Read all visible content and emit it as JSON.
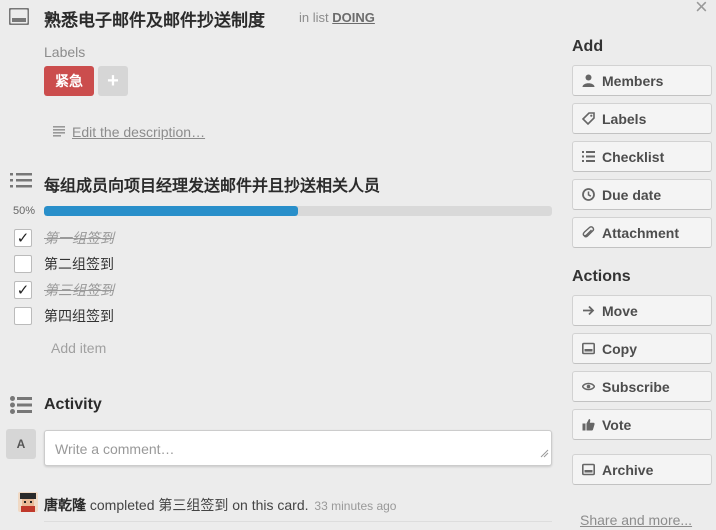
{
  "card": {
    "title": "熟悉电子邮件及邮件抄送制度",
    "in_list_prefix": "in list",
    "list_name": "DOING",
    "close_glyph": "×"
  },
  "labels": {
    "title": "Labels",
    "items": [
      {
        "text": "紧急",
        "color": "#cb4d4d"
      }
    ],
    "add_glyph": "+"
  },
  "description": {
    "edit_link": "Edit the description…"
  },
  "checklist": {
    "title": "每组成员向项目经理发送邮件并且抄送相关人员",
    "percent_label": "50%",
    "progress": 0.5,
    "items": [
      {
        "text": "第一组签到",
        "checked": true
      },
      {
        "text": "第二组签到",
        "checked": false
      },
      {
        "text": "第三组签到",
        "checked": true
      },
      {
        "text": "第四组签到",
        "checked": false
      }
    ],
    "add_item": "Add item"
  },
  "activity": {
    "title": "Activity",
    "avatar_initial": "A",
    "comment_placeholder": "Write a comment…",
    "entry": {
      "user": "唐乾隆",
      "action": "completed 第三组签到 on this card.",
      "time": "33 minutes ago"
    }
  },
  "sidebar": {
    "add_title": "Add",
    "add_buttons": [
      {
        "label": "Members",
        "icon": "person-icon"
      },
      {
        "label": "Labels",
        "icon": "tag-icon"
      },
      {
        "label": "Checklist",
        "icon": "checklist-icon"
      },
      {
        "label": "Due date",
        "icon": "clock-icon"
      },
      {
        "label": "Attachment",
        "icon": "paperclip-icon"
      }
    ],
    "actions_title": "Actions",
    "action_buttons": [
      {
        "label": "Move",
        "icon": "arrow-right-icon"
      },
      {
        "label": "Copy",
        "icon": "card-icon"
      },
      {
        "label": "Subscribe",
        "icon": "eye-icon"
      },
      {
        "label": "Vote",
        "icon": "thumbs-up-icon"
      }
    ],
    "archive_button": {
      "label": "Archive",
      "icon": "archive-icon"
    },
    "share_link": "Share and more..."
  },
  "colors": {
    "progress_fill": "#298fca",
    "label_red": "#cb4d4d",
    "background": "#ececec"
  }
}
